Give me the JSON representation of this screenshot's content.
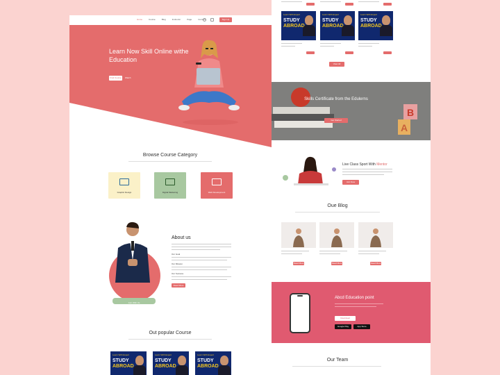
{
  "nav": {
    "links": [
      "Home",
      "Course",
      "Blog",
      "Instructor",
      "Page",
      "Contact"
    ],
    "cta": "Sign Up"
  },
  "hero": {
    "title": "Learn Now Skill Online withe Education",
    "btn_primary": "Find Course",
    "btn_secondary": "Watch",
    "bg_color": "#e46c6c"
  },
  "categories": {
    "title": "Browse Course Category",
    "items": [
      {
        "label": "Graphic Design",
        "color": "#fbf1c8",
        "icon": "monitor-icon"
      },
      {
        "label": "Digital Marketing",
        "color": "#a8c8a0",
        "icon": "chart-icon"
      },
      {
        "label": "Web Development",
        "color": "#e46c6c",
        "icon": "code-icon"
      }
    ]
  },
  "about": {
    "title": "About us",
    "items": [
      "Our Goal",
      "Our Mission",
      "Our Success"
    ],
    "btn": "Read More",
    "badge": "Join With Us"
  },
  "popular": {
    "title": "Out popular Course",
    "card_sub": "Learn With Expert",
    "card_line1": "STUDY",
    "card_line2": "ABROAD"
  },
  "right_courses": {
    "card_sub": "Learn With Expert",
    "card_line1": "STUDY",
    "card_line2": "ABROAD",
    "view_all": "View All"
  },
  "certificate": {
    "title": "Skills Certificate from the Edulerns",
    "btn": "Get Started"
  },
  "live": {
    "title": "Live Class Sport With",
    "highlight": "Mentor",
    "btn": "Join Now"
  },
  "blog": {
    "title": "Oue Blog",
    "btn": "Read More"
  },
  "app": {
    "title": "Abcd Education point",
    "btn": "Download",
    "google_play": "Google Play",
    "app_store": "App Store"
  },
  "team": {
    "title": "Our Team"
  }
}
